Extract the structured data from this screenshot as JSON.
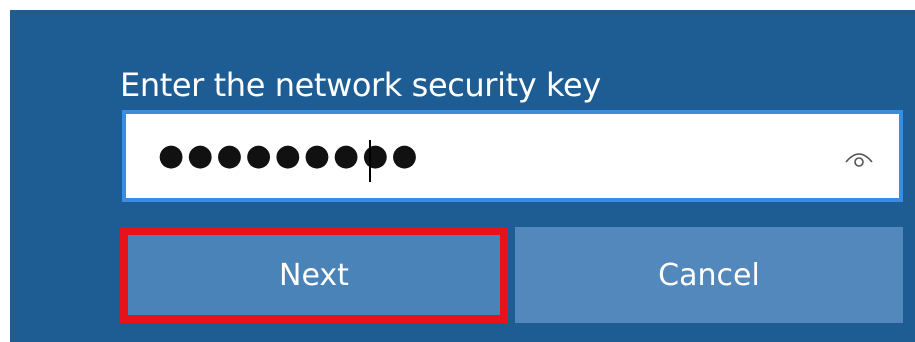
{
  "dialog": {
    "prompt": "Enter the network security key",
    "key_field": {
      "masked_value": "●●●●●●●●●"
    },
    "reveal_icon": "eye-icon",
    "next_label": "Next",
    "cancel_label": "Cancel"
  },
  "colors": {
    "panel_background": "#1e5c94",
    "field_border_focus": "#3b8de2",
    "next_button": "#4a83b8",
    "cancel_button": "#5288bc",
    "highlight_outline": "#e6131a"
  }
}
